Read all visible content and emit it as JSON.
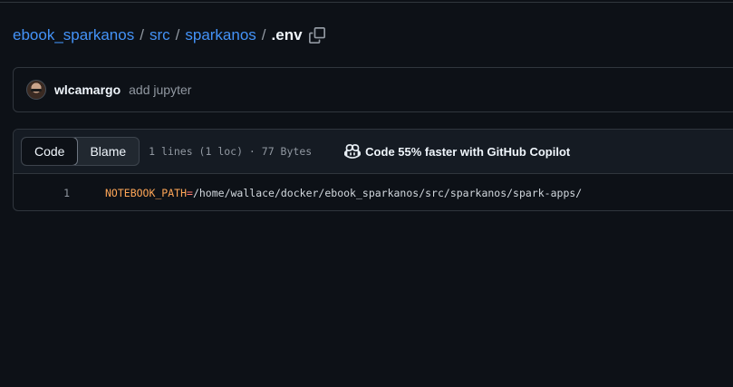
{
  "breadcrumb": {
    "repo": "ebook_sparkanos",
    "sep": "/",
    "dir1": "src",
    "dir2": "sparkanos",
    "file": ".env"
  },
  "commit": {
    "author": "wlcamargo",
    "message": "add jupyter"
  },
  "file_header": {
    "code_tab": "Code",
    "blame_tab": "Blame",
    "meta": "1 lines (1 loc) · 77 Bytes",
    "copilot_label": "Code 55% faster with GitHub Copilot"
  },
  "code": {
    "line_number": "1",
    "key": "NOTEBOOK_PATH",
    "eq": "=",
    "value": "/home/wallace/docker/ebook_sparkanos/src/sparkanos/spark-apps/"
  },
  "icons": {
    "copy": "copy-icon",
    "copilot": "copilot-icon"
  },
  "colors": {
    "link": "#4493f8",
    "background": "#0d1117",
    "key": "#ffa657"
  }
}
